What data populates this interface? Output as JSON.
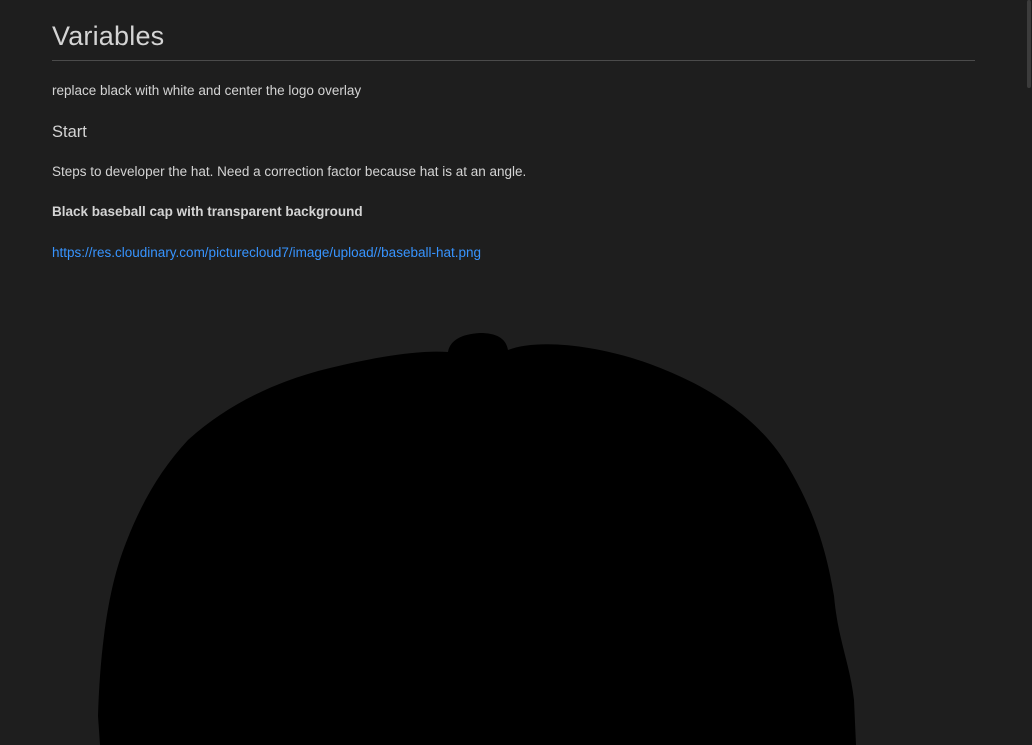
{
  "document": {
    "heading": "Variables",
    "intro": "replace black with white and center the logo overlay",
    "section_heading": "Start",
    "steps_text": "Steps to developer the hat. Need a correction factor because hat is at an angle.",
    "bold_caption": "Black baseball cap with transparent background",
    "image_link": "https://res.cloudinary.com/picturecloud7/image/upload//baseball-hat.png"
  },
  "image": {
    "icon": "baseball-cap-image",
    "color": "#000000"
  },
  "colors": {
    "background": "#1e1e1e",
    "text": "#d4d4d4",
    "link": "#3794ff",
    "rule": "#4b4b4b"
  }
}
